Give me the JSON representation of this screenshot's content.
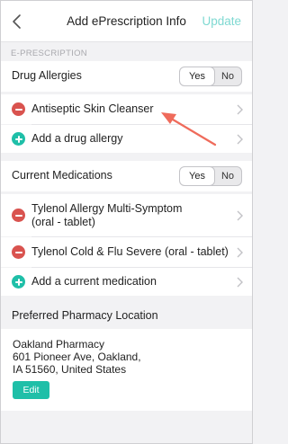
{
  "nav": {
    "title": "Add ePrescription Info",
    "update_label": "Update"
  },
  "section_caption": "E-PRESCRIPTION",
  "allergies": {
    "label": "Drug Allergies",
    "toggle": {
      "yes": "Yes",
      "no": "No",
      "selected": "Yes"
    },
    "items": [
      {
        "text": "Antiseptic Skin Cleanser"
      }
    ],
    "add_label": "Add a drug allergy"
  },
  "medications": {
    "label": "Current Medications",
    "toggle": {
      "yes": "Yes",
      "no": "No",
      "selected": "Yes"
    },
    "items": [
      {
        "line1": "Tylenol Allergy Multi-Symptom",
        "line2": "(oral - tablet)"
      },
      {
        "text": "Tylenol Cold & Flu Severe (oral - tablet)"
      }
    ],
    "add_label": "Add a current medication"
  },
  "pharmacy": {
    "header": "Preferred Pharmacy Location",
    "name": "Oakland Pharmacy",
    "address_line1": "601 Pioneer Ave, Oakland,",
    "address_line2": "IA 51560, United States",
    "edit_label": "Edit"
  },
  "colors": {
    "accent": "#1fbfa8",
    "remove": "#d9534f",
    "update_text": "#7fd9d2",
    "annotation_arrow": "#ef6b5b"
  },
  "icons": {
    "back": "chevron-left-icon",
    "row_arrow": "chevron-right-icon",
    "remove": "minus-circle-icon",
    "add": "plus-circle-icon"
  }
}
